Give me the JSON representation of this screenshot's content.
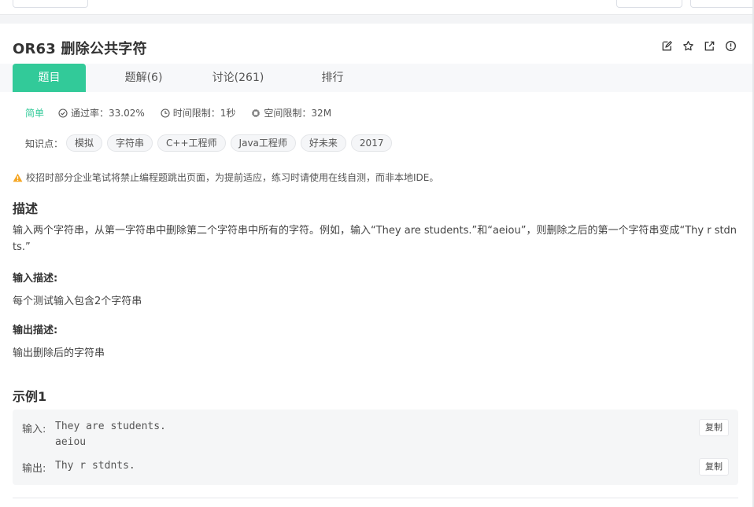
{
  "problem": {
    "title": "OR63  删除公共字符"
  },
  "tabs": [
    {
      "label": "题目"
    },
    {
      "label": "题解(6)"
    },
    {
      "label": "讨论(261)"
    },
    {
      "label": "排行"
    }
  ],
  "meta": {
    "difficulty": "简单",
    "pass_rate": "通过率：33.02%",
    "time_limit": "时间限制：1秒",
    "memory_limit": "空间限制：32M"
  },
  "knowledge": {
    "label": "知识点：",
    "tags": [
      "模拟",
      "字符串",
      "C++工程师",
      "Java工程师",
      "好未来",
      "2017"
    ]
  },
  "notice": "校招时部分企业笔试将禁止编程题跳出页面，为提前适应，练习时请使用在线自测，而非本地IDE。",
  "description": {
    "heading": "描述",
    "text": "输入两个字符串，从第一字符串中删除第二个字符串中所有的字符。例如，输入“They are students.”和“aeiou”，则删除之后的第一个字符串变成“Thy r stdnts.”"
  },
  "input_desc": {
    "heading": "输入描述:",
    "text": "每个测试输入包含2个字符串"
  },
  "output_desc": {
    "heading": "输出描述:",
    "text": "输出删除后的字符串"
  },
  "example": {
    "heading": "示例1",
    "input_label": "输入:",
    "input_line1": "They are students.",
    "input_line2": "aeiou",
    "output_label": "输出:",
    "output_value": "Thy r stdnts.",
    "copy_label": "复制"
  },
  "colors": {
    "accent": "#32ca99",
    "warning": "#f5a623"
  }
}
